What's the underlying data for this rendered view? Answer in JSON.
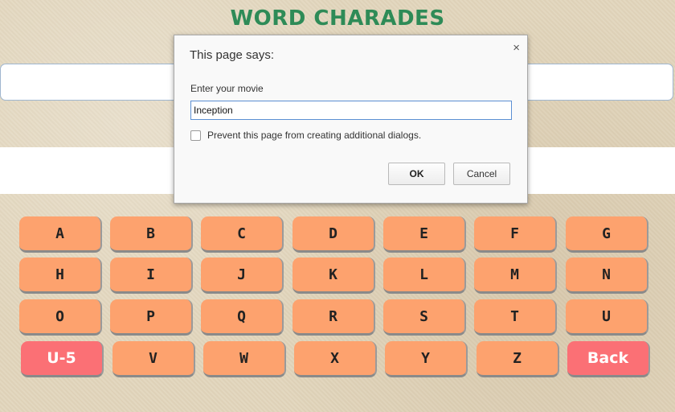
{
  "app": {
    "title": "WORD CHARADES"
  },
  "keyboard": {
    "rows": [
      [
        "A",
        "B",
        "C",
        "D",
        "E",
        "F",
        "G"
      ],
      [
        "H",
        "I",
        "J",
        "K",
        "L",
        "M",
        "N"
      ],
      [
        "O",
        "P",
        "Q",
        "R",
        "S",
        "T",
        "U"
      ],
      [
        "U-5",
        "V",
        "W",
        "X",
        "Y",
        "Z",
        "Back"
      ]
    ],
    "special_keys": [
      "U-5",
      "Back"
    ]
  },
  "dialog": {
    "title": "This page says:",
    "close_symbol": "×",
    "prompt": "Enter your movie",
    "input_value": "Inception",
    "checkbox_label": "Prevent this page from creating additional dialogs.",
    "checkbox_checked": false,
    "ok_label": "OK",
    "cancel_label": "Cancel"
  },
  "colors": {
    "title": "#2e8b57",
    "key": "#fda26e",
    "special_key": "#fb7075",
    "background": "#e2d6bd"
  }
}
